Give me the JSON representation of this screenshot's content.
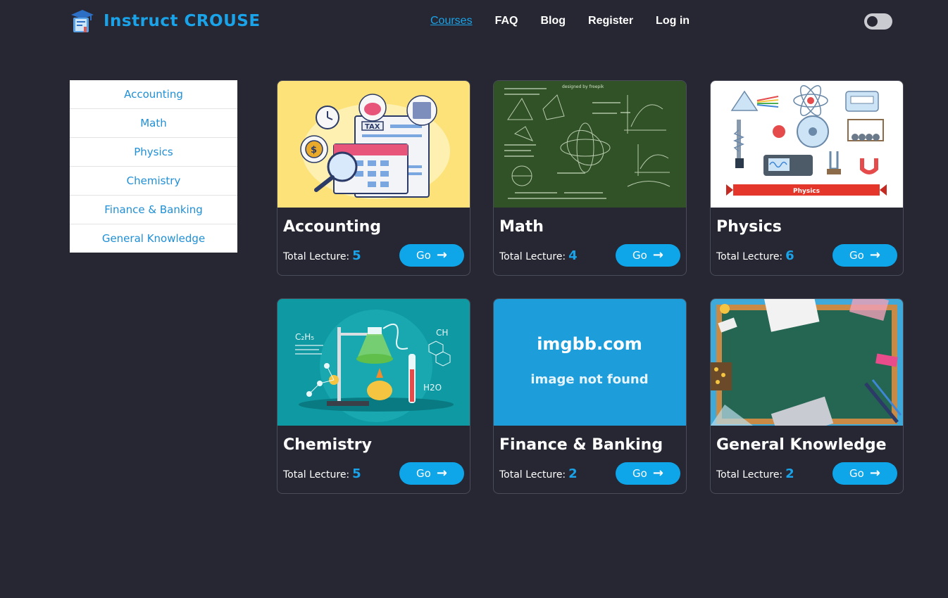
{
  "header": {
    "brand": "Instruct CROUSE",
    "nav": [
      {
        "label": "Courses",
        "active": true
      },
      {
        "label": "FAQ",
        "active": false
      },
      {
        "label": "Blog",
        "active": false
      },
      {
        "label": "Register",
        "active": false
      },
      {
        "label": "Log in",
        "active": false
      }
    ],
    "theme_toggle": "dark-mode-toggle"
  },
  "sidebar": {
    "items": [
      {
        "label": "Accounting"
      },
      {
        "label": "Math"
      },
      {
        "label": "Physics"
      },
      {
        "label": "Chemistry"
      },
      {
        "label": "Finance & Banking"
      },
      {
        "label": "General Knowledge"
      }
    ]
  },
  "courses": [
    {
      "title": "Accounting",
      "lecture_label": "Total Lecture:",
      "lectures": "5",
      "button": "Go",
      "image": "accounting-tax-illustration"
    },
    {
      "title": "Math",
      "lecture_label": "Total Lecture:",
      "lectures": "4",
      "button": "Go",
      "image": "math-chalkboard-illustration",
      "image_credit": "designed by freepik"
    },
    {
      "title": "Physics",
      "lecture_label": "Total Lecture:",
      "lectures": "6",
      "button": "Go",
      "image": "physics-equipment-illustration",
      "image_banner": "Physics"
    },
    {
      "title": "Chemistry",
      "lecture_label": "Total Lecture:",
      "lectures": "5",
      "button": "Go",
      "image": "chemistry-lab-illustration",
      "image_formulas": [
        "CH",
        "H2O"
      ]
    },
    {
      "title": "Finance & Banking",
      "lecture_label": "Total Lecture:",
      "lectures": "2",
      "button": "Go",
      "image": "image-not-found-placeholder",
      "image_text": [
        "imgbb.com",
        "image not found"
      ]
    },
    {
      "title": "General Knowledge",
      "lecture_label": "Total Lecture:",
      "lectures": "2",
      "button": "Go",
      "image": "green-chalkboard-illustration"
    }
  ],
  "colors": {
    "background": "#262733",
    "accent": "#1aa3e8",
    "button": "#0ea5e9",
    "card_border": "#4a4c59"
  }
}
